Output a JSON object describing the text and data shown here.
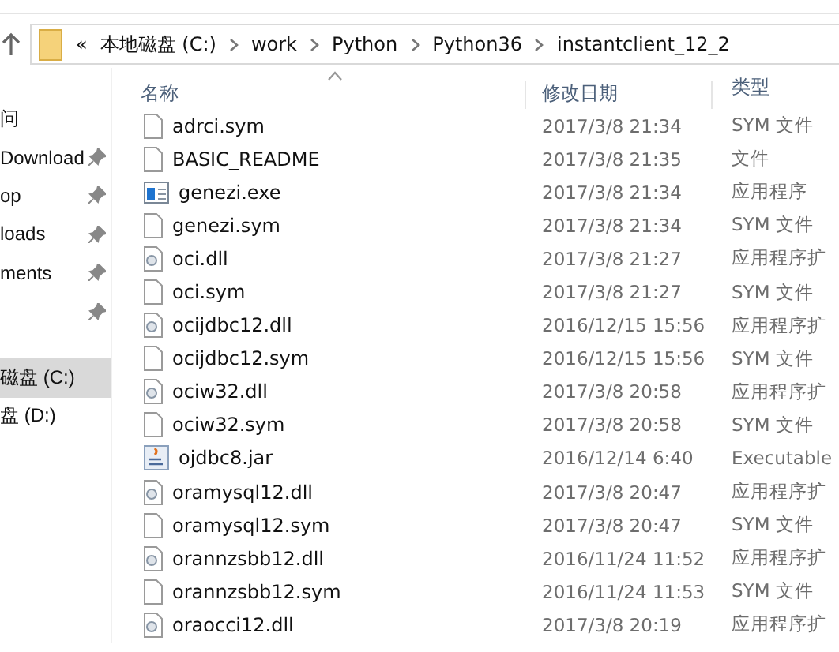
{
  "address_bar": {
    "overflow": "«",
    "path": [
      "本地磁盘 (C:)",
      "work",
      "Python",
      "Python36",
      "instantclient_12_2"
    ]
  },
  "sidebar": {
    "items": [
      {
        "label": "问",
        "pinned": false,
        "selected": false
      },
      {
        "label": "Download",
        "pinned": true,
        "selected": false
      },
      {
        "label": "op",
        "pinned": true,
        "selected": false
      },
      {
        "label": "loads",
        "pinned": true,
        "selected": false
      },
      {
        "label": "ments",
        "pinned": true,
        "selected": false
      },
      {
        "pinned": true,
        "selected": false
      },
      {
        "label": "磁盘 (C:)",
        "pinned": false,
        "selected": true
      },
      {
        "label": "盘 (D:)",
        "pinned": false,
        "selected": false
      }
    ]
  },
  "table": {
    "columns": [
      "名称",
      "修改日期",
      "类型"
    ],
    "rows": [
      {
        "kind": "file",
        "name": "adrci.sym",
        "date": "2017/3/8 21:34",
        "type": "SYM 文件"
      },
      {
        "kind": "file",
        "name": "BASIC_README",
        "date": "2017/3/8 21:35",
        "type": "文件"
      },
      {
        "kind": "exe",
        "name": "genezi.exe",
        "date": "2017/3/8 21:34",
        "type": "应用程序"
      },
      {
        "kind": "file",
        "name": "genezi.sym",
        "date": "2017/3/8 21:34",
        "type": "SYM 文件"
      },
      {
        "kind": "dll",
        "name": "oci.dll",
        "date": "2017/3/8 21:27",
        "type": "应用程序扩"
      },
      {
        "kind": "file",
        "name": "oci.sym",
        "date": "2017/3/8 21:27",
        "type": "SYM 文件"
      },
      {
        "kind": "dll",
        "name": "ocijdbc12.dll",
        "date": "2016/12/15 15:56",
        "type": "应用程序扩"
      },
      {
        "kind": "file",
        "name": "ocijdbc12.sym",
        "date": "2016/12/15 15:56",
        "type": "SYM 文件"
      },
      {
        "kind": "dll",
        "name": "ociw32.dll",
        "date": "2017/3/8 20:58",
        "type": "应用程序扩"
      },
      {
        "kind": "file",
        "name": "ociw32.sym",
        "date": "2017/3/8 20:58",
        "type": "SYM 文件"
      },
      {
        "kind": "jar",
        "name": "ojdbc8.jar",
        "date": "2016/12/14 6:40",
        "type": "Executable"
      },
      {
        "kind": "dll",
        "name": "oramysql12.dll",
        "date": "2017/3/8 20:47",
        "type": "应用程序扩"
      },
      {
        "kind": "file",
        "name": "oramysql12.sym",
        "date": "2017/3/8 20:47",
        "type": "SYM 文件"
      },
      {
        "kind": "dll",
        "name": "orannzsbb12.dll",
        "date": "2016/11/24 11:52",
        "type": "应用程序扩"
      },
      {
        "kind": "file",
        "name": "orannzsbb12.sym",
        "date": "2016/11/24 11:53",
        "type": "SYM 文件"
      },
      {
        "kind": "dll",
        "name": "oraocci12.dll",
        "date": "2017/3/8 20:19",
        "type": "应用程序扩"
      }
    ]
  }
}
